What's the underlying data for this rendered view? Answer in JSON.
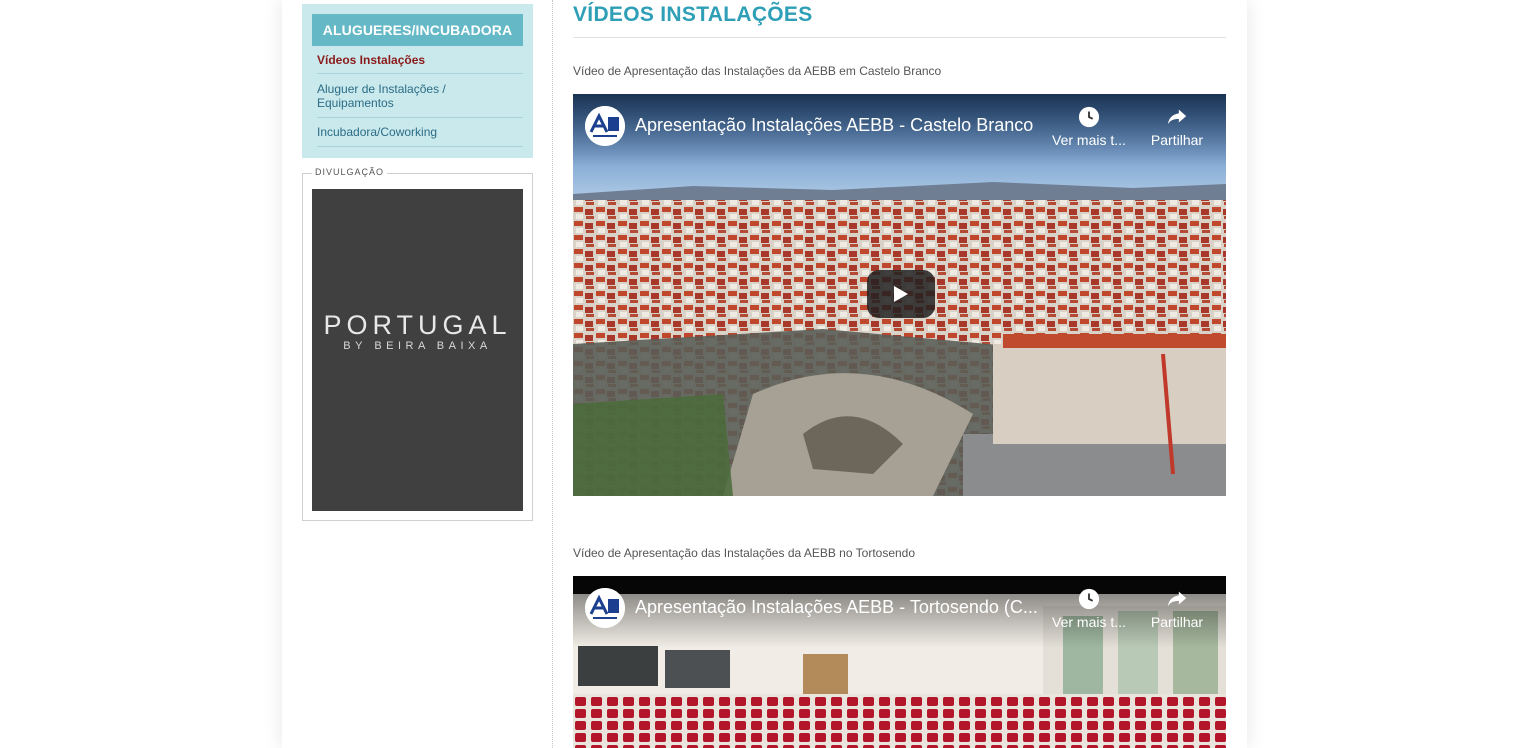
{
  "sidebar": {
    "section_title": "ALUGUERES/INCUBADORA",
    "items": [
      {
        "label": "Vídeos Instalações",
        "active": true
      },
      {
        "label": "Aluguer de Instalações / Equipamentos",
        "active": false
      },
      {
        "label": "Incubadora/Coworking",
        "active": false
      }
    ],
    "divulgacao": {
      "label": "DIVULGAÇÃO",
      "banner_title": "PORTUGAL",
      "banner_subtitle": "BY BEIRA BAIXA"
    }
  },
  "main": {
    "title": "VÍDEOS INSTALAÇÕES",
    "videos": [
      {
        "caption": "Vídeo de Apresentação das Instalações da AEBB em Castelo Branco",
        "title": "Apresentação Instalações AEBB - Castelo Branco",
        "watch_later_label": "Ver mais t...",
        "share_label": "Partilhar"
      },
      {
        "caption": "Vídeo de Apresentação das Instalações da AEBB no Tortosendo",
        "title": "Apresentação Instalações AEBB - Tortosendo (C...",
        "watch_later_label": "Ver mais t...",
        "share_label": "Partilhar"
      }
    ]
  },
  "colors": {
    "accent": "#2e9fb6",
    "menu_bg": "#c9e9ec",
    "menu_title_bg": "#65b9c6",
    "active_item": "#8b1a1a",
    "link": "#2b6c86"
  }
}
